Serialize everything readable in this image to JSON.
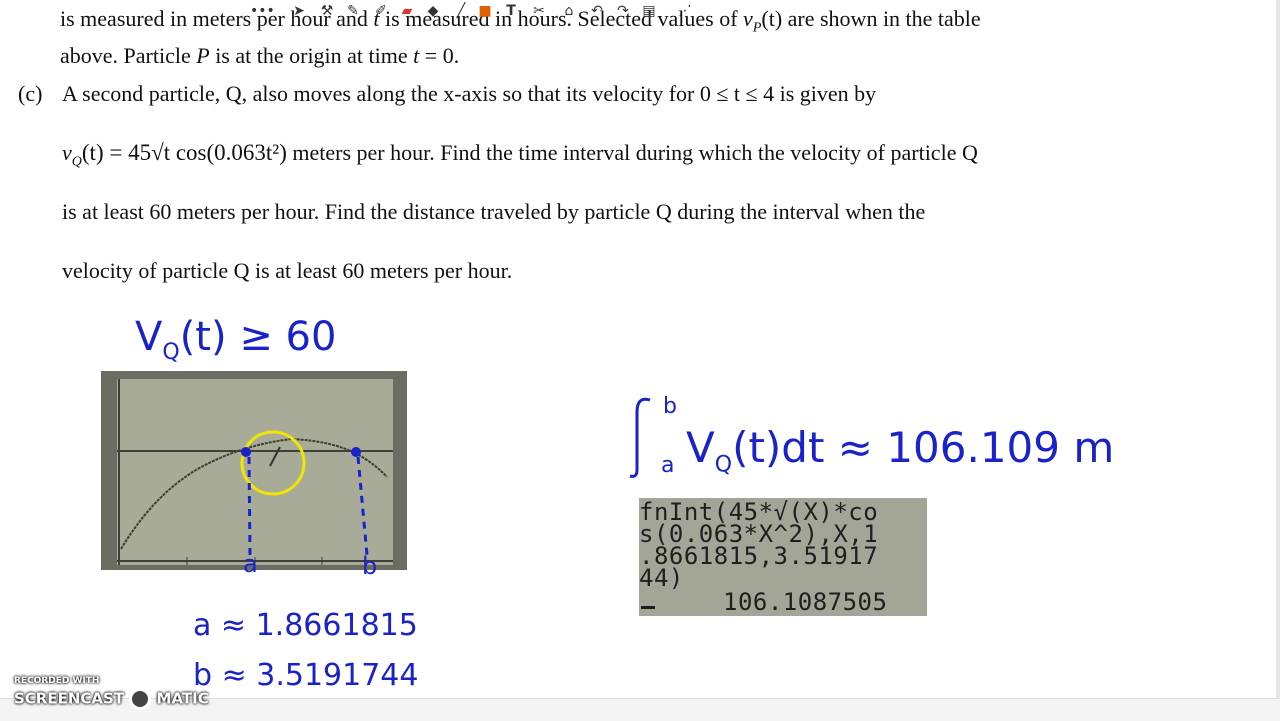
{
  "problem": {
    "line1_a": "is measured in meters per hour and ",
    "line1_t": "t",
    "line1_b": " is measured in hours. Selected values of ",
    "line1_v": "v",
    "line1_sub": "P",
    "line1_c": "(t) are shown in the table",
    "line2_a": "above. Particle ",
    "line2_P": "P",
    "line2_b": " is at the origin at time ",
    "line2_t": "t",
    "line2_c": " = 0.",
    "part_label": "(c)",
    "line3": "A second particle, Q, also moves along the x-axis so that its velocity for 0 ≤ t ≤ 4 is given by",
    "line4_formula": "v",
    "line4_sub": "Q",
    "line4_rest": "(t) = 45√t cos(0.063t²)",
    "line4_tail": " meters per hour. Find the time interval during which the velocity of particle Q",
    "line5": "is at least 60 meters per hour. Find the distance traveled by particle Q during the interval when the",
    "line6": "velocity of particle Q is at least 60 meters per hour."
  },
  "handwriting": {
    "inequality": "V",
    "inequality_sub": "Q",
    "inequality_rest": "(t) ≥ 60",
    "label_a": "a",
    "label_b": "b",
    "a_value": "a ≈ 1.8661815",
    "b_value": "b ≈ 3.5191744",
    "integral_upper": "b",
    "integral_lower": "a",
    "integral_body": "V",
    "integral_sub": "Q",
    "integral_rest": "(t)dt ≈ 106.109  m"
  },
  "ti_screen": {
    "row1": "fnInt(45*√(X)*co",
    "row2": "s(0.063*X^2),X,1",
    "row3": ".8661815,3.51917",
    "row4": "44)",
    "result": "106.1087505"
  },
  "recorder": {
    "line1": "RECORDED WITH",
    "line2": "SCREENCAST",
    "line3": "MATIC"
  },
  "toolbar": {
    "icons": [
      "dots",
      "pointer",
      "tools",
      "pen",
      "highlighter",
      "eraser",
      "fill",
      "line",
      "shape",
      "text",
      "clear",
      "undo",
      "redo",
      "pages",
      "more"
    ]
  }
}
